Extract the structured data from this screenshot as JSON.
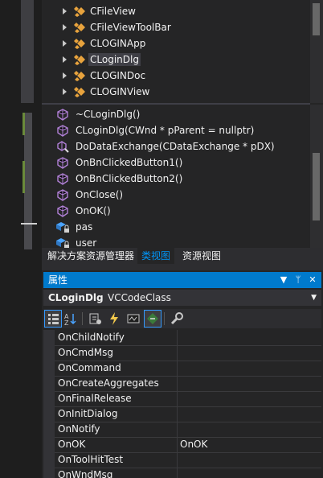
{
  "class_view": {
    "tree": [
      {
        "label": "CFileView",
        "selected": false
      },
      {
        "label": "CFileViewToolBar",
        "selected": false
      },
      {
        "label": "CLOGINApp",
        "selected": false
      },
      {
        "label": "CLoginDlg",
        "selected": true
      },
      {
        "label": "CLOGINDoc",
        "selected": false
      },
      {
        "label": "CLOGINView",
        "selected": false
      }
    ],
    "members": [
      {
        "label": "~CLoginDlg()",
        "icon": "method-icon"
      },
      {
        "label": "CLoginDlg(CWnd * pParent = nullptr)",
        "icon": "method-icon"
      },
      {
        "label": "DoDataExchange(CDataExchange * pDX)",
        "icon": "protected-method-icon"
      },
      {
        "label": "OnBnClickedButton1()",
        "icon": "method-icon"
      },
      {
        "label": "OnBnClickedButton2()",
        "icon": "method-icon"
      },
      {
        "label": "OnClose()",
        "icon": "method-icon"
      },
      {
        "label": "OnOK()",
        "icon": "method-icon"
      },
      {
        "label": "pas",
        "icon": "private-field-icon"
      },
      {
        "label": "user",
        "icon": "private-field-icon"
      }
    ]
  },
  "tabs": [
    {
      "label": "解决方案资源管理器",
      "active": false
    },
    {
      "label": "类视图",
      "active": true
    },
    {
      "label": "资源视图",
      "active": false
    }
  ],
  "properties": {
    "title": "属性",
    "buttons": {
      "dropdown": "▼",
      "pin": "ᛘ",
      "close": "✕"
    },
    "object_name": "CLoginDlg",
    "object_type": "VCCodeClass",
    "toolbar": [
      "categorized-icon",
      "alphabetical-icon",
      "properties-icon",
      "events-icon",
      "messages-icon",
      "overrides-icon",
      "property-pages-icon"
    ],
    "rows": [
      {
        "name": "OnChildNotify",
        "value": ""
      },
      {
        "name": "OnCmdMsg",
        "value": ""
      },
      {
        "name": "OnCommand",
        "value": ""
      },
      {
        "name": "OnCreateAggregates",
        "value": ""
      },
      {
        "name": "OnFinalRelease",
        "value": ""
      },
      {
        "name": "OnInitDialog",
        "value": ""
      },
      {
        "name": "OnNotify",
        "value": ""
      },
      {
        "name": "OnOK",
        "value": "OnOK"
      },
      {
        "name": "OnToolHitTest",
        "value": ""
      },
      {
        "name": "OnWndMsg",
        "value": ""
      }
    ]
  },
  "colors": {
    "accent": "#007acc",
    "active_tab": "#0097fb",
    "class_icon": "#e8a33d",
    "method_icon": "#b180d7"
  }
}
